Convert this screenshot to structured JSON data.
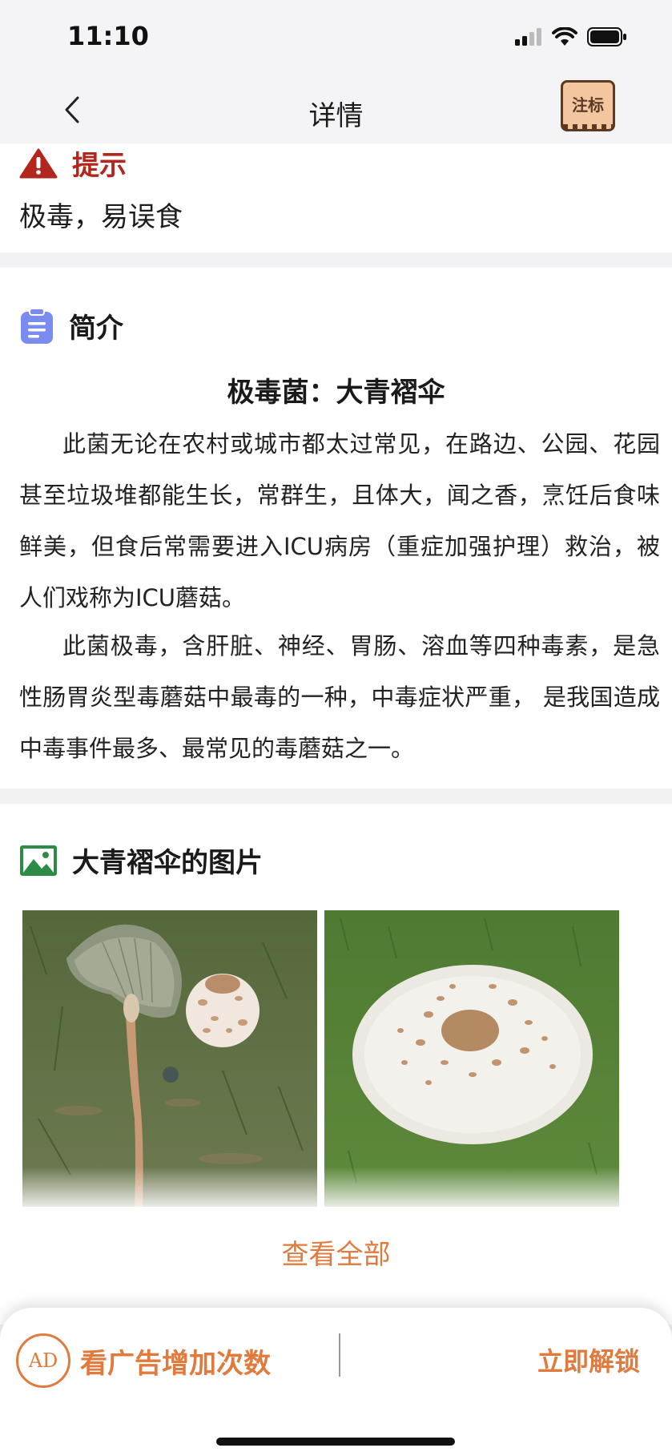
{
  "status_bar": {
    "time": "11:10"
  },
  "nav": {
    "title": "详情",
    "annotate_label": "注标"
  },
  "tip": {
    "title": "提示",
    "text": "极毒，易误食"
  },
  "intro": {
    "title": "简介",
    "heading": "极毒菌：大青褶伞",
    "paragraphs": [
      "此菌无论在农村或城市都太过常见，在路边、公园、花园甚至垃圾堆都能生长，常群生，且体大，闻之香，烹饪后食味鲜美，但食后常需要进入ICU病房（重症加强护理）救治，被人们戏称为ICU蘑菇。",
      "此菌极毒，含肝脏、神经、胃肠、溶血等四种毒素，是急性肠胃炎型毒蘑菇中最毒的一种，中毒症状严重， 是我国造成中毒事件最多、最常见的毒蘑菇之一。"
    ]
  },
  "images": {
    "title": "大青褶伞的图片",
    "view_all": "查看全部"
  },
  "bottom_bar": {
    "ad_badge": "AD",
    "ad_text": "看广告增加次数",
    "unlock_text": "立即解锁"
  },
  "colors": {
    "accent": "#e07a3d",
    "warning": "#b3261e",
    "intro_icon": "#7b8cf0",
    "image_icon": "#2e8b45"
  }
}
